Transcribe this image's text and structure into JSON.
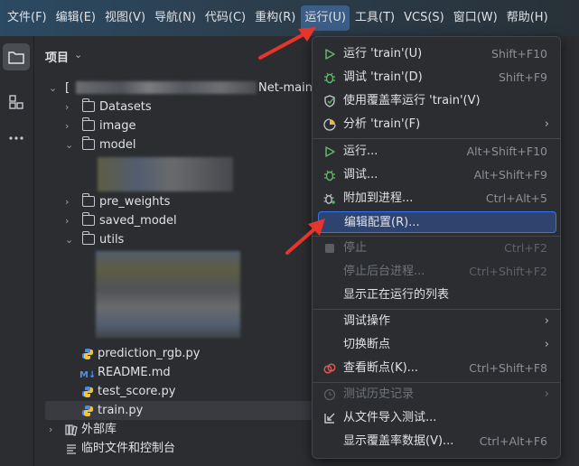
{
  "menubar": {
    "items": [
      "文件(F)",
      "编辑(E)",
      "视图(V)",
      "导航(N)",
      "代码(C)",
      "重构(R)",
      "运行(U)",
      "工具(T)",
      "VCS(S)",
      "窗口(W)",
      "帮助(H)"
    ],
    "active_index": 6
  },
  "project_panel": {
    "title": "项目",
    "root_suffix": "Net-main]",
    "tree": {
      "datasets": "Datasets",
      "image": "image",
      "model": "model",
      "pre_weights": "pre_weights",
      "saved_model": "saved_model",
      "utils": "utils",
      "prediction": "prediction_rgb.py",
      "readme": "README.md",
      "md_badge": "M↓",
      "test_score": "test_score.py",
      "train": "train.py",
      "external_libs": "外部库",
      "scratches": "临时文件和控制台"
    }
  },
  "run_menu": {
    "items": {
      "run_train": {
        "label": "运行 'train'(U)",
        "shortcut": "Shift+F10"
      },
      "debug_train": {
        "label": "调试 'train'(D)",
        "shortcut": "Shift+F9"
      },
      "coverage_train": {
        "label": "使用覆盖率运行 'train'(V)",
        "shortcut": ""
      },
      "profile_train": {
        "label": "分析 'train'(F)",
        "submenu": "›"
      },
      "run": {
        "label": "运行...",
        "shortcut": "Alt+Shift+F10"
      },
      "debug": {
        "label": "调试...",
        "shortcut": "Alt+Shift+F9"
      },
      "attach": {
        "label": "附加到进程...",
        "shortcut": "Ctrl+Alt+5"
      },
      "edit_config": {
        "label": "编辑配置(R)...",
        "shortcut": ""
      },
      "stop": {
        "label": "停止",
        "shortcut": "Ctrl+F2"
      },
      "stop_background": {
        "label": "停止后台进程...",
        "shortcut": "Ctrl+Shift+F2"
      },
      "show_running": {
        "label": "显示正在运行的列表",
        "shortcut": ""
      },
      "debug_actions": {
        "label": "调试操作",
        "submenu": "›"
      },
      "toggle_breakpoint": {
        "label": "切换断点",
        "submenu": "›"
      },
      "view_breakpoints": {
        "label": "查看断点(K)...",
        "shortcut": "Ctrl+Shift+F8"
      },
      "test_history": {
        "label": "测试历史记录",
        "submenu": "›"
      },
      "import_tests": {
        "label": "从文件导入测试...",
        "shortcut": ""
      },
      "show_coverage": {
        "label": "显示覆盖率数据(V)...",
        "shortcut": "Ctrl+Alt+F6"
      }
    }
  },
  "colors": {
    "accent": "#3574f0",
    "highlight": "#2e436e",
    "annotation_arrow": "#e8352b",
    "run_green": "#5fb865"
  }
}
